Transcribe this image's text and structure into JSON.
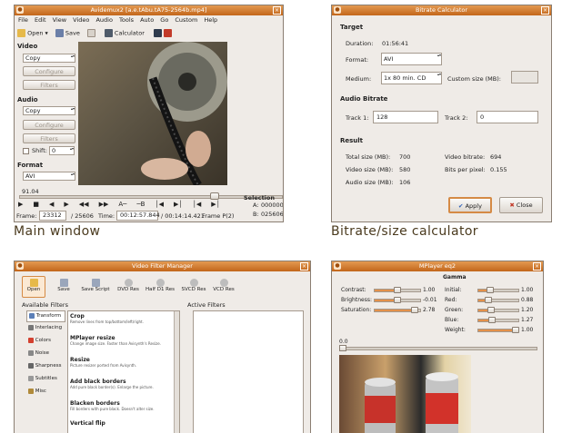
{
  "main_window": {
    "title": "Avidemux2 [a.e.tAbu.tA75-2564b.mp4]",
    "menu": [
      "File",
      "Edit",
      "View",
      "Video",
      "Audio",
      "Tools",
      "Auto",
      "Go",
      "Custom",
      "Help"
    ],
    "toolbar": {
      "open": "Open",
      "save": "Save",
      "calculator": "Calculator"
    },
    "video_section": {
      "label": "Video",
      "codec": "Copy",
      "configure": "Configure",
      "filters": "Filters"
    },
    "audio_section": {
      "label": "Audio",
      "codec": "Copy",
      "configure": "Configure",
      "filters": "Filters",
      "shift_label": "Shift:",
      "shift_value": "0"
    },
    "format_section": {
      "label": "Format",
      "format": "AVI"
    },
    "position_value": "91.04",
    "selection_label": "Selection",
    "selection_a_label": "A:",
    "selection_a": "000000",
    "selection_b_label": "B:",
    "selection_b": "025606",
    "status": {
      "frame_label": "Frame:",
      "frame_value": "23312",
      "total_frames": "/ 25606",
      "time_label": "Time:",
      "time_value": "00:12:57.844",
      "duration": "/ 00:14:14.421",
      "frame_type": "Frame P(2)"
    },
    "caption": "Main window"
  },
  "bitrate_calculator": {
    "title": "Bitrate Calculator",
    "target_label": "Target",
    "duration_label": "Duration:",
    "duration_value": "01:56:41",
    "format_label": "Format:",
    "format_value": "AVI",
    "medium_label": "Medium:",
    "medium_value": "1x 80 min. CD",
    "custom_size_label": "Custom size (MB):",
    "audio_bitrate_label": "Audio Bitrate",
    "track1_label": "Track 1:",
    "track1_value": "128",
    "track2_label": "Track 2:",
    "track2_value": "0",
    "result_label": "Result",
    "total_size_label": "Total size (MB):",
    "total_size_value": "700",
    "video_size_label": "Video size (MB):",
    "video_size_value": "580",
    "audio_size_label": "Audio size (MB):",
    "audio_size_value": "106",
    "video_bitrate_label": "Video bitrate:",
    "video_bitrate_value": "694",
    "bits_per_pixel_label": "Bits per pixel:",
    "bits_per_pixel_value": "0.155",
    "apply_label": "Apply",
    "close_label": "Close",
    "caption": "Bitrate/size calculator"
  },
  "filter_manager": {
    "title": "Video Filter Manager",
    "toolbar": [
      "Open",
      "Save",
      "Save Script",
      "DVD Res",
      "Half D1 Res",
      "SVCD Res",
      "VCD Res"
    ],
    "available_filters_label": "Available Filters",
    "active_filters_label": "Active Filters",
    "categories": [
      "Transform",
      "Interlacing",
      "Colors",
      "Noise",
      "Sharpness",
      "Subtitles",
      "Misc"
    ],
    "filters": [
      {
        "name": "Crop",
        "desc": "Remove lines from top/bottom/left/right."
      },
      {
        "name": "MPlayer resize",
        "desc": "Change image size. Faster than Avisynth's Resize."
      },
      {
        "name": "Resize",
        "desc": "Picture resizer ported from Avisynth."
      },
      {
        "name": "Add black borders",
        "desc": "Add pure black border(s). Enlarge the picture."
      },
      {
        "name": "Blacken borders",
        "desc": "Fill borders with pure black. Doesn't alter size."
      },
      {
        "name": "Vertical flip",
        "desc": ""
      }
    ]
  },
  "mplayer_eq": {
    "title": "MPlayer eq2",
    "gamma_label": "Gamma",
    "left_sliders": [
      {
        "label": "Contrast:",
        "value": "1.00",
        "fill": 0.5
      },
      {
        "label": "Brightness:",
        "value": "-0.01",
        "fill": 0.49
      },
      {
        "label": "Saturation:",
        "value": "2.78",
        "fill": 0.93
      }
    ],
    "right_sliders": [
      {
        "label": "Initial:",
        "value": "1.00",
        "fill": 0.25
      },
      {
        "label": "Red:",
        "value": "0.88",
        "fill": 0.22
      },
      {
        "label": "Green:",
        "value": "1.20",
        "fill": 0.3
      },
      {
        "label": "Blue:",
        "value": "1.27",
        "fill": 0.32
      },
      {
        "label": "Weight:",
        "value": "1.00",
        "fill": 1.0
      }
    ],
    "position_value": "0.0"
  }
}
